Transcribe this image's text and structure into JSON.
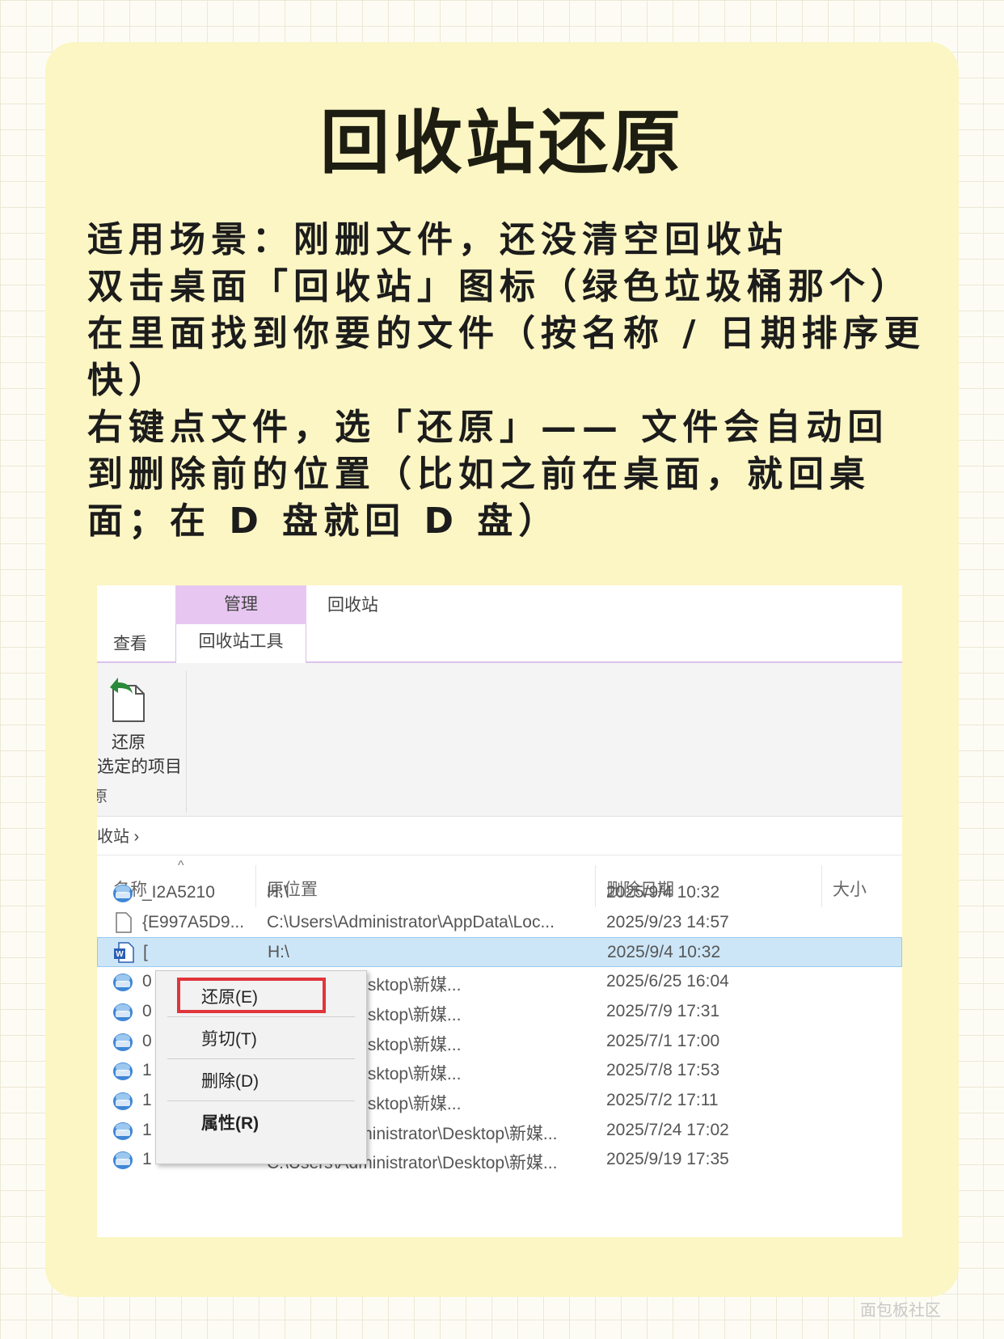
{
  "title": "回收站还原",
  "paragraphs": [
    "适用场景：刚删文件，还没清空回收站",
    "双击桌面「回收站」图标（绿色垃圾桶那个）",
    "在里面找到你要的文件（按名称 / 日期排序更快）",
    "右键点文件，选「还原」—— 文件会自动回到删除前的位置（比如之前在桌面，就回桌面；在 D 盘就回 D 盘）"
  ],
  "explorer": {
    "context_tab": "管理",
    "window_title": "回收站",
    "tab_view": "查看",
    "tab_tools": "回收站工具",
    "ribbon_button_line1": "还原",
    "ribbon_button_line2": "选定的项目",
    "ribbon_group": "原",
    "address": "收站 ›",
    "columns": [
      "名称",
      "原位置",
      "删除日期",
      "大小"
    ],
    "rows": [
      {
        "name": "_I2A5210",
        "location": "H:\\",
        "date": "2025/9/4 10:32",
        "icon": "photo-icon"
      },
      {
        "name": "{E997A5D9...",
        "location": "C:\\Users\\Administrator\\AppData\\Loc...",
        "date": "2025/9/23 14:57",
        "icon": "blank-file-icon"
      },
      {
        "name": "[",
        "location": "H:\\",
        "date": "2025/9/4 10:32",
        "icon": "word-icon"
      },
      {
        "name": "0",
        "location": "ninistrator\\Desktop\\新媒...",
        "date": "2025/6/25 16:04",
        "icon": "photo-icon"
      },
      {
        "name": "0",
        "location": "ninistrator\\Desktop\\新媒...",
        "date": "2025/7/9 17:31",
        "icon": "photo-icon"
      },
      {
        "name": "0",
        "location": "ninistrator\\Desktop\\新媒...",
        "date": "2025/7/1 17:00",
        "icon": "photo-icon"
      },
      {
        "name": "1",
        "location": "ninistrator\\Desktop\\新媒...",
        "date": "2025/7/8 17:53",
        "icon": "photo-icon"
      },
      {
        "name": "1",
        "location": "ninistrator\\Desktop\\新媒...",
        "date": "2025/7/2 17:11",
        "icon": "photo-icon"
      },
      {
        "name": "1",
        "location": "C:\\Users\\Administrator\\Desktop\\新媒...",
        "date": "2025/7/24 17:02",
        "icon": "photo-icon"
      },
      {
        "name": "1",
        "location": "C:\\Users\\Administrator\\Desktop\\新媒...",
        "date": "2025/9/19 17:35",
        "icon": "photo-icon"
      }
    ],
    "selected_row": 2,
    "context_menu": [
      "还原(E)",
      "剪切(T)",
      "删除(D)",
      "属性(R)"
    ],
    "highlight_color": "#e0353b"
  },
  "watermark": "面包板社区"
}
